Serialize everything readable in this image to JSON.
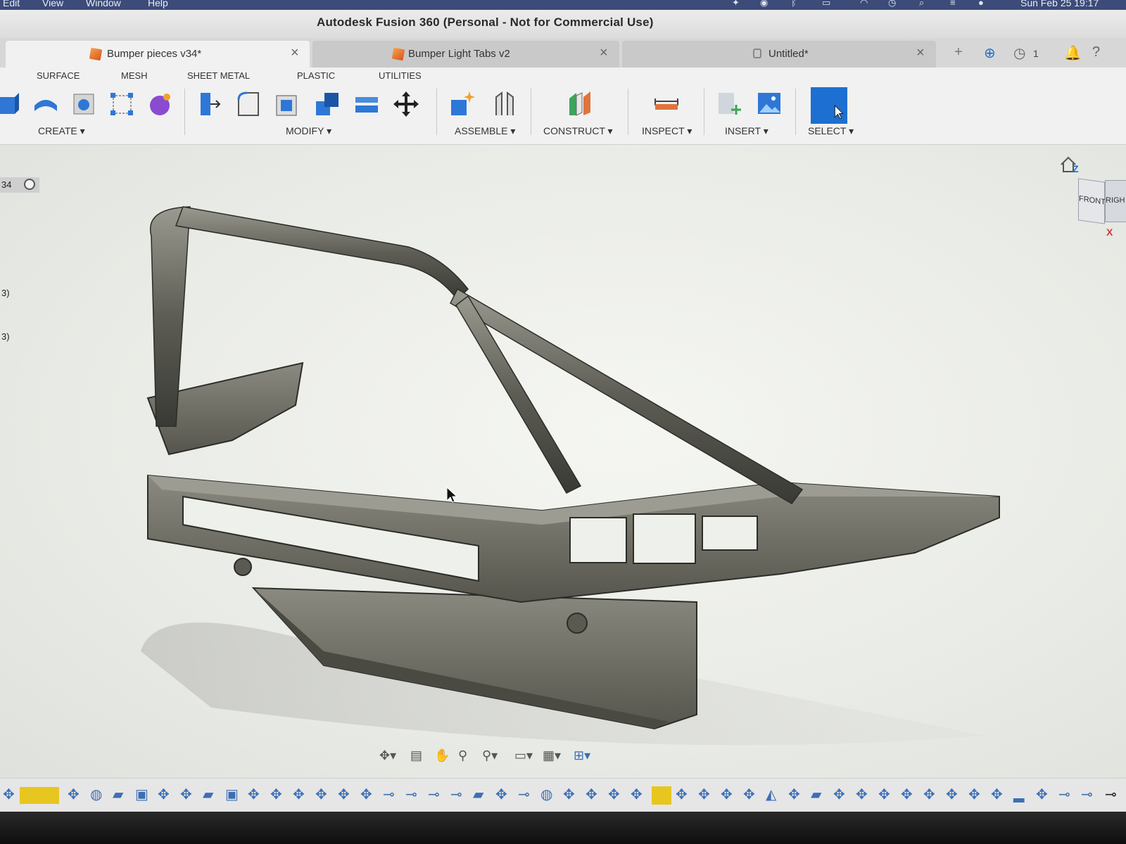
{
  "menubar": {
    "items": [
      "Edit",
      "View",
      "Window",
      "Help"
    ],
    "clock": "Sun Feb 25  19:17"
  },
  "window": {
    "title": "Autodesk Fusion 360 (Personal - Not for Commercial Use)"
  },
  "tabs": [
    {
      "label": "Bumper pieces v34*",
      "active": true
    },
    {
      "label": "Bumper Light Tabs v2",
      "active": false
    },
    {
      "label": "Untitled*",
      "active": false
    }
  ],
  "tabbar": {
    "jobs_count": "1"
  },
  "workspace_tabs": [
    "SURFACE",
    "MESH",
    "SHEET METAL",
    "PLASTIC",
    "UTILITIES"
  ],
  "toolbar_groups": [
    "CREATE",
    "MODIFY",
    "ASSEMBLE",
    "CONSTRUCT",
    "INSPECT",
    "INSERT",
    "SELECT"
  ],
  "browser": {
    "version_tag": "34",
    "item_a": "3)",
    "item_b": "3)"
  },
  "viewcube": {
    "front": "FRONT",
    "right": "RIGH",
    "z_axis": "Z",
    "x_axis": "X"
  },
  "colors": {
    "accent": "#1d6fd1",
    "menubar": "#3c4b78",
    "model": "#6d6d63"
  }
}
